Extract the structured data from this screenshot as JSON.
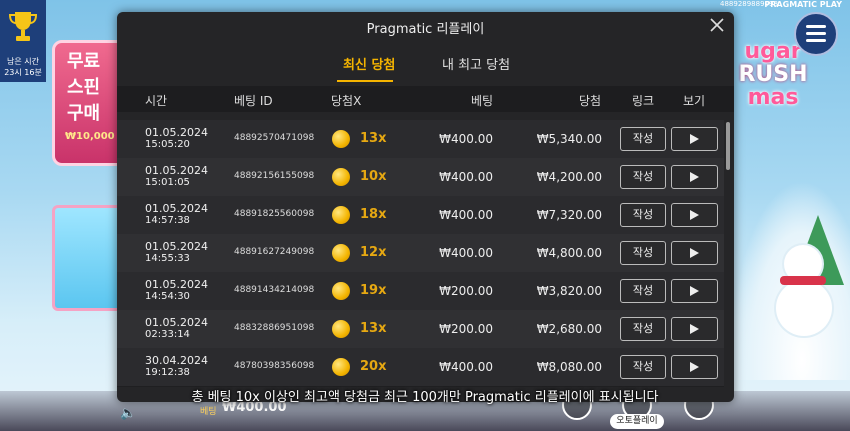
{
  "hud": {
    "time_label": "남은 시간",
    "time_value": "23시 16분",
    "top_id": "4889289889098",
    "brand": "PRAGMATIC PLAY",
    "bet_label": "베팅",
    "bet_value": "₩400.00",
    "autoplay_label": "오토플레이"
  },
  "background": {
    "left_sign_lines": [
      "무료",
      "스핀",
      "구매"
    ],
    "left_sign_price": "₩10,000",
    "logo_lines": [
      "ugar",
      "RUSH",
      "mas"
    ]
  },
  "modal": {
    "title": "Pragmatic 리플레이",
    "tabs": [
      {
        "label": "최신 당첨",
        "active": true
      },
      {
        "label": "내 최고 당첨",
        "active": false
      }
    ],
    "columns": {
      "time": "시간",
      "bet_id": "베팅 ID",
      "multiplier": "당첨X",
      "bet": "베팅",
      "win": "당첨",
      "link": "링크",
      "view": "보기"
    },
    "button_write": "작성",
    "rows": [
      {
        "date": "01.05.2024",
        "time": "15:05:20",
        "bet_id": "48892570471098",
        "mult": "13x",
        "bet": "₩400.00",
        "win": "₩5,340.00"
      },
      {
        "date": "01.05.2024",
        "time": "15:01:05",
        "bet_id": "48892156155098",
        "mult": "10x",
        "bet": "₩400.00",
        "win": "₩4,200.00"
      },
      {
        "date": "01.05.2024",
        "time": "14:57:38",
        "bet_id": "48891825560098",
        "mult": "18x",
        "bet": "₩400.00",
        "win": "₩7,320.00"
      },
      {
        "date": "01.05.2024",
        "time": "14:55:33",
        "bet_id": "48891627249098",
        "mult": "12x",
        "bet": "₩400.00",
        "win": "₩4,800.00"
      },
      {
        "date": "01.05.2024",
        "time": "14:54:30",
        "bet_id": "48891434214098",
        "mult": "19x",
        "bet": "₩200.00",
        "win": "₩3,820.00"
      },
      {
        "date": "01.05.2024",
        "time": "02:33:14",
        "bet_id": "48832886951098",
        "mult": "13x",
        "bet": "₩200.00",
        "win": "₩2,680.00"
      },
      {
        "date": "30.04.2024",
        "time": "19:12:38",
        "bet_id": "48780398356098",
        "mult": "20x",
        "bet": "₩400.00",
        "win": "₩8,080.00"
      }
    ]
  },
  "footer_note": "총 베팅 10x 이상인 최고액 당첨금 최근 100개만 Pragmatic 리플레이에 표시됩니다",
  "colors": {
    "modal_bg": "#252527",
    "accent": "#f5b400",
    "hud_blue": "#1e3f7a"
  }
}
